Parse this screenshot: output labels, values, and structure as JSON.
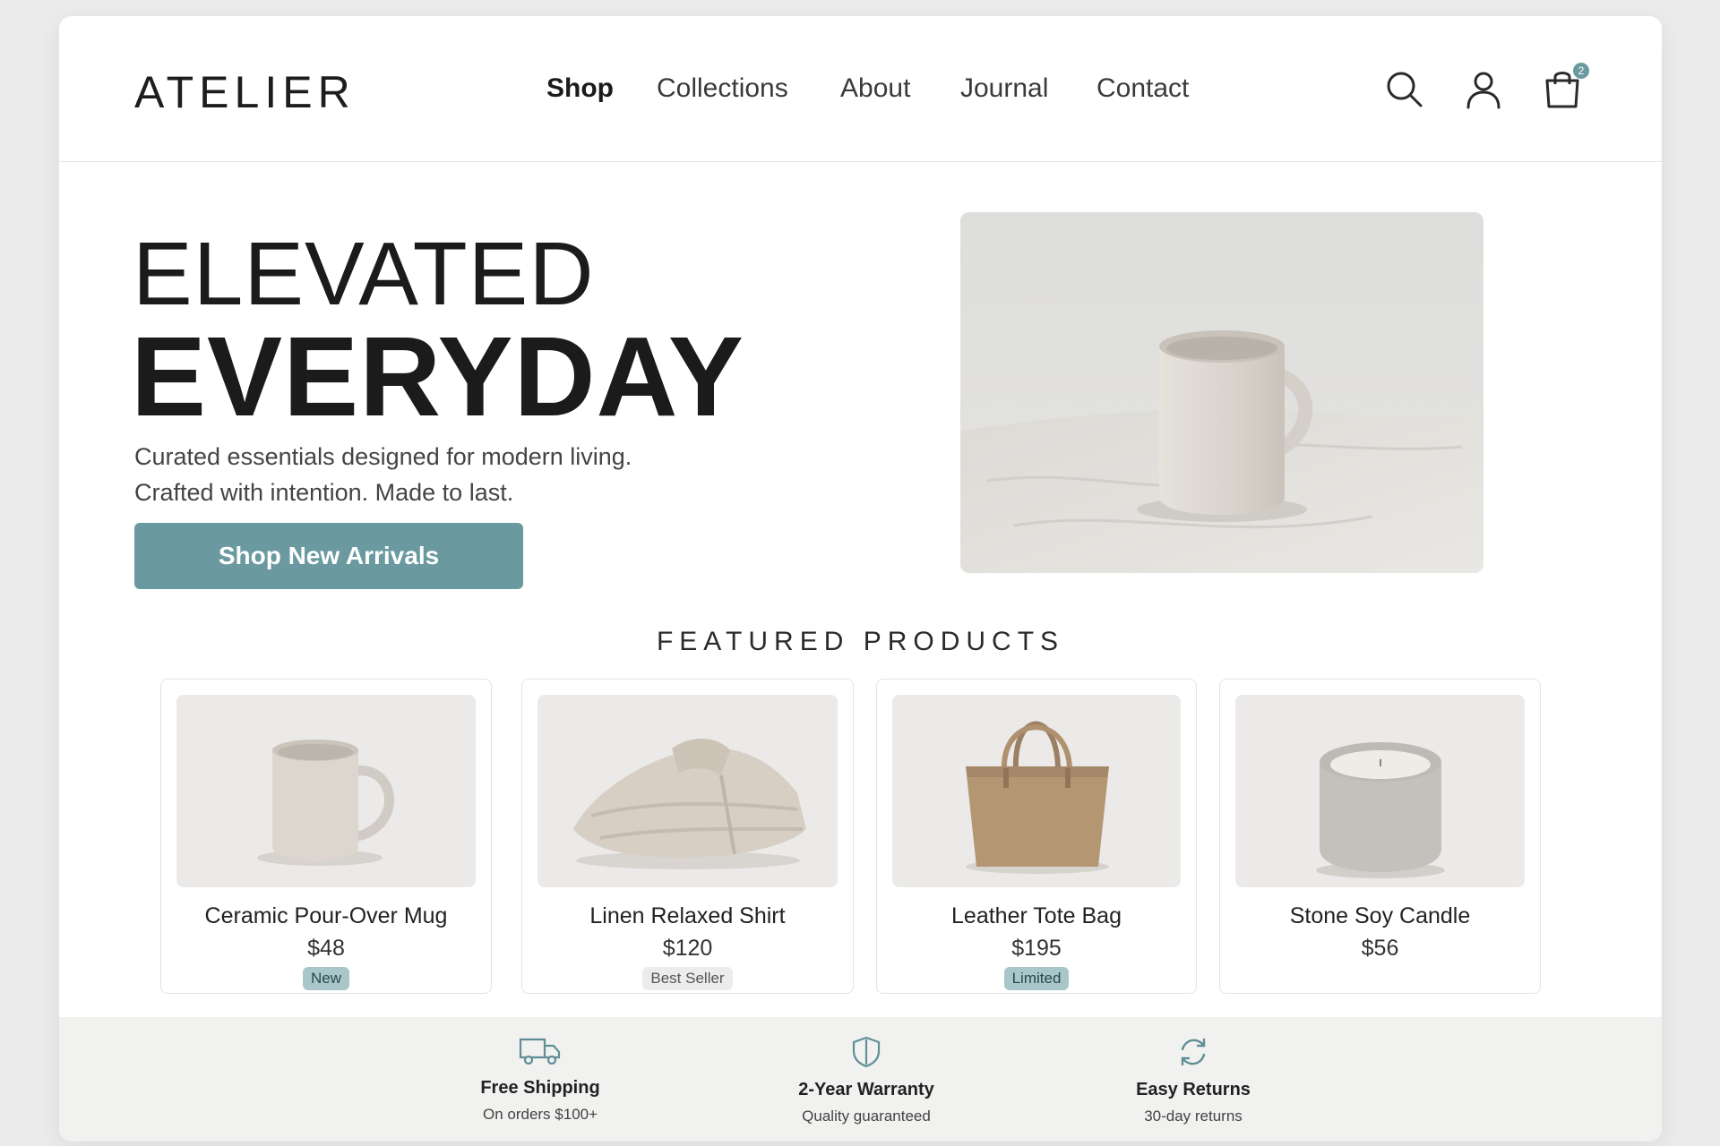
{
  "brand": {
    "logo": "ATELIER"
  },
  "nav": {
    "items": [
      "Shop",
      "Collections",
      "About",
      "Journal",
      "Contact"
    ],
    "active": "Shop"
  },
  "header_icons": {
    "search": "search-icon",
    "account": "user-icon",
    "cart": "shopping-bag-icon",
    "cart_count": "2"
  },
  "hero": {
    "line1": "ELEVATED",
    "line2": "EVERYDAY",
    "desc1": "Curated essentials designed for modern living.",
    "desc2": "Crafted with intention. Made to last.",
    "cta": "Shop New Arrivals"
  },
  "featured": {
    "title": "FEATURED PRODUCTS",
    "products": [
      {
        "name": "Ceramic Pour-Over Mug",
        "price": "$48",
        "badge": "New",
        "badge_style": "teal",
        "image": "mug"
      },
      {
        "name": "Linen Relaxed Shirt",
        "price": "$120",
        "badge": "Best Seller",
        "badge_style": "gray",
        "image": "shirt"
      },
      {
        "name": "Leather Tote Bag",
        "price": "$195",
        "badge": "Limited",
        "badge_style": "teal",
        "image": "tote"
      },
      {
        "name": "Stone Soy Candle",
        "price": "$56",
        "badge": "",
        "badge_style": "",
        "image": "candle"
      }
    ]
  },
  "features": [
    {
      "icon": "truck-icon",
      "title": "Free Shipping",
      "sub": "On orders $100+"
    },
    {
      "icon": "shield-icon",
      "title": "2-Year Warranty",
      "sub": "Quality guaranteed"
    },
    {
      "icon": "refresh-icon",
      "title": "Easy Returns",
      "sub": "30-day returns"
    }
  ],
  "colors": {
    "accent": "#6a9aa0",
    "badge_teal": "#a9c6c9",
    "badge_gray": "#ececec",
    "strip_bg": "#f1f1f0",
    "text": "#1b1b1b"
  }
}
